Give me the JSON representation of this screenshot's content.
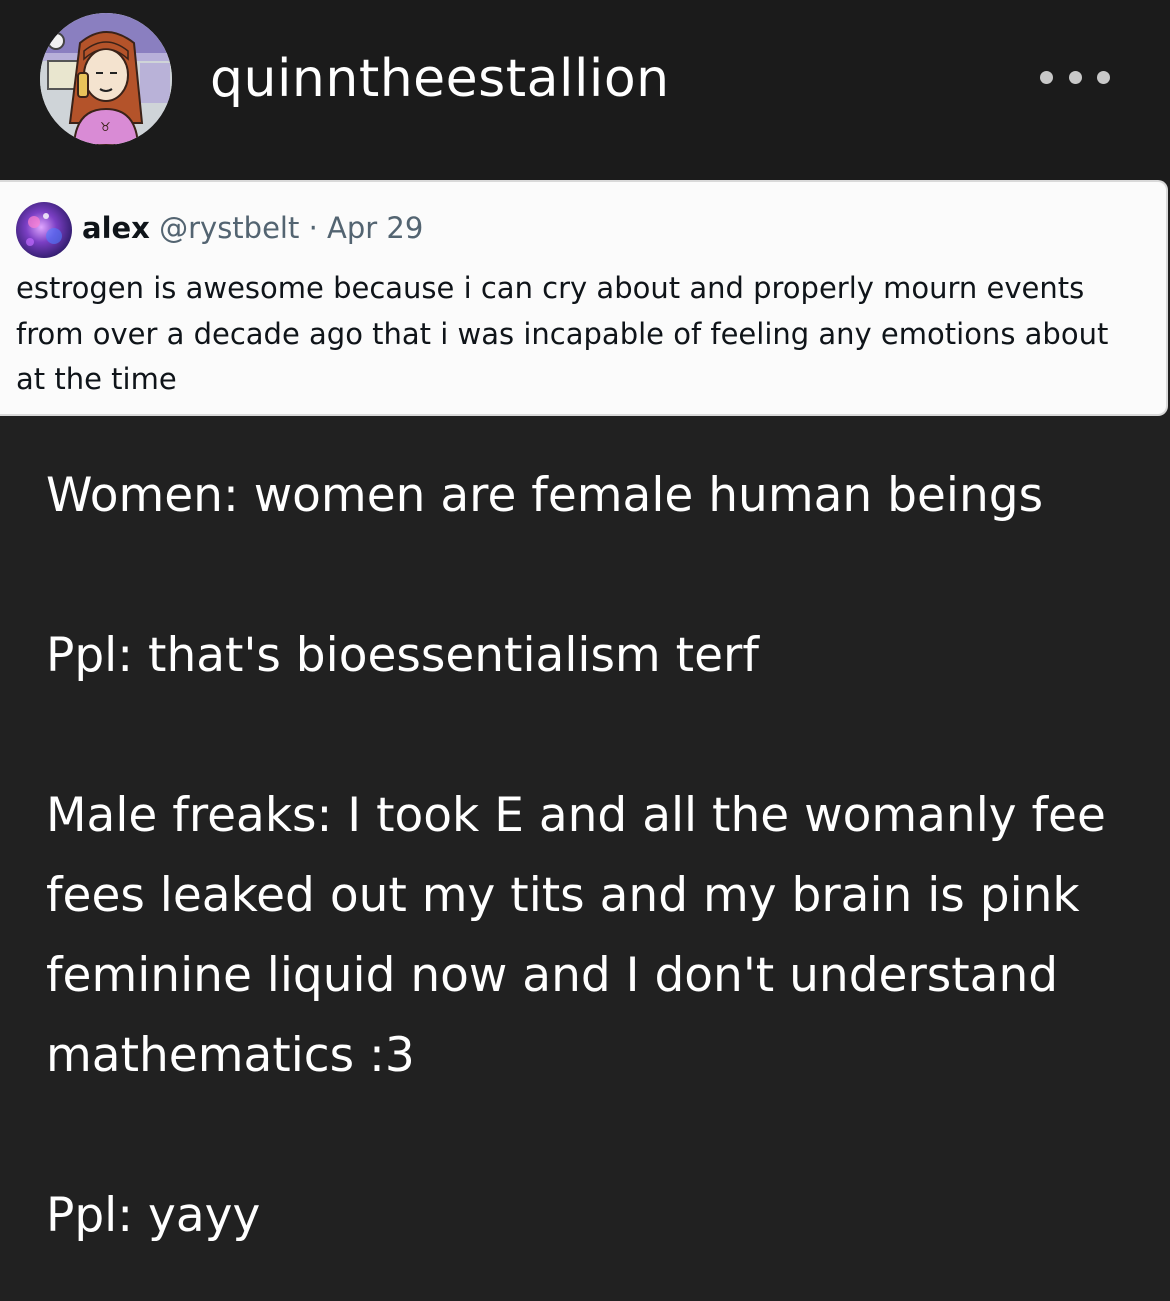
{
  "post": {
    "username": "quinntheestallion",
    "avatar_icon": "cartoon-woman-on-phone-avatar",
    "more_icon": "more-options-ellipsis-icon"
  },
  "quoted_tweet": {
    "display_name": "alex",
    "handle": "@rystbelt",
    "separator": "·",
    "date": "Apr 29",
    "avatar_icon": "purple-galaxy-avatar",
    "text": "estrogen is awesome because i can cry about and properly mourn events from over a decade ago that i was incapable of feeling any emotions about at the time"
  },
  "body": {
    "paragraphs": [
      "Women: women are female human beings",
      "Ppl: that's bioessentialism terf",
      "Male freaks: I took E and all the womanly fee fees leaked out my tits and my brain is pink feminine liquid now and I don't understand mathematics :3",
      "Ppl: yayy"
    ]
  },
  "colors": {
    "background": "#212121",
    "header_background": "#1b1b1b",
    "quote_background": "#fbfbfb",
    "quote_text": "#0f1419",
    "quote_meta": "#536471"
  }
}
